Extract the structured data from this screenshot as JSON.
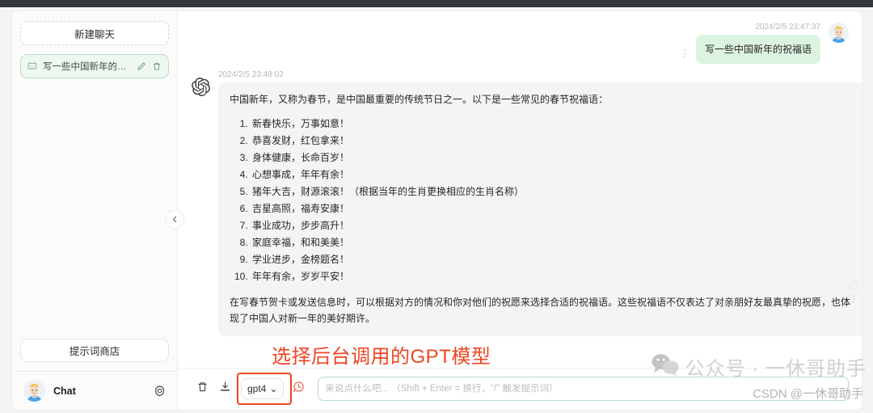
{
  "window": {
    "titlebar_color": "#33373b"
  },
  "sidebar": {
    "new_chat_label": "新建聊天",
    "chat_items": [
      {
        "title": "写一些中国新年的…",
        "icon": "message-icon",
        "edit_icon": "pencil-icon",
        "delete_icon": "trash-icon"
      }
    ],
    "prompt_store_label": "提示词商店",
    "footer": {
      "name": "Chat",
      "avatar": "user-avatar",
      "settings_icon": "gear-icon"
    },
    "collapse_icon": "chevron-left-icon"
  },
  "conversation": {
    "messages": [
      {
        "role": "user",
        "timestamp": "2024/2/5 23:47:37",
        "text": "写一些中国新年的祝福语"
      },
      {
        "role": "assistant",
        "timestamp": "2024/2/5 23:48:02",
        "intro": "中国新年，又称为春节，是中国最重要的传统节日之一。以下是一些常见的春节祝福语：",
        "list": [
          "新春快乐，万事如意！",
          "恭喜发财，红包拿来！",
          "身体健康，长命百岁！",
          "心想事成，年年有余！",
          "猪年大吉，财源滚滚！（根据当年的生肖更换相应的生肖名称）",
          "吉星高照，福寿安康！",
          "事业成功，步步高升！",
          "家庭幸福，和和美美！",
          "学业进步，金榜题名！",
          "年年有余，岁岁平安！"
        ],
        "outro": "在写春节贺卡或发送信息时，可以根据对方的情况和你对他们的祝愿来选择合适的祝福语。这些祝福语不仅表达了对亲朋好友最真挚的祝愿，也体现了中国人对新一年的美好期许。"
      }
    ]
  },
  "composer": {
    "clear_icon": "trash-icon",
    "export_icon": "download-icon",
    "model_value": "gpt4",
    "model_caret": "⌄",
    "history_icon": "clock-icon",
    "input_value": "",
    "input_placeholder": "来说点什么吧... （Shift + Enter = 换行，\"/\" 触发提示词）"
  },
  "annotations": {
    "model_note": "选择后台调用的GPT模型",
    "note_color": "#ef4423",
    "highlight_color": "#ef4423"
  },
  "watermark": {
    "wechat_icon": "wechat-icon",
    "text": "公众号 · 一休哥助手",
    "csdn_text": "CSDN @一休哥助手"
  }
}
